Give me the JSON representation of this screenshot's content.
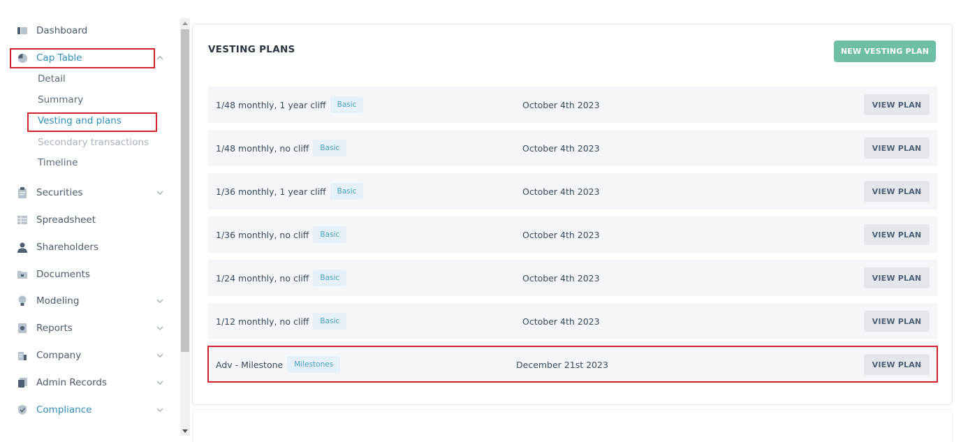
{
  "sidebar": {
    "items": [
      {
        "label": "Dashboard",
        "icon": "dashboard-icon"
      },
      {
        "label": "Cap Table",
        "icon": "pie-chart-icon"
      },
      {
        "label": "Securities",
        "icon": "clipboard-icon"
      },
      {
        "label": "Spreadsheet",
        "icon": "spreadsheet-icon"
      },
      {
        "label": "Shareholders",
        "icon": "person-icon"
      },
      {
        "label": "Documents",
        "icon": "folder-icon"
      },
      {
        "label": "Modeling",
        "icon": "lightbulb-icon"
      },
      {
        "label": "Reports",
        "icon": "report-icon"
      },
      {
        "label": "Company",
        "icon": "building-icon"
      },
      {
        "label": "Admin Records",
        "icon": "admin-records-icon"
      },
      {
        "label": "Compliance",
        "icon": "shield-check-icon"
      }
    ],
    "cap_table_sub": [
      {
        "label": "Detail"
      },
      {
        "label": "Summary"
      },
      {
        "label": "Vesting and plans"
      },
      {
        "label": "Secondary transactions"
      },
      {
        "label": "Timeline"
      }
    ]
  },
  "main": {
    "title": "VESTING PLANS",
    "new_button": "NEW VESTING PLAN",
    "view_label": "VIEW PLAN",
    "plans": [
      {
        "name": "1/48 monthly, 1 year cliff",
        "tag": "Basic",
        "date": "October 4th 2023"
      },
      {
        "name": "1/48 monthly, no cliff",
        "tag": "Basic",
        "date": "October 4th 2023"
      },
      {
        "name": "1/36 monthly, 1 year cliff",
        "tag": "Basic",
        "date": "October 4th 2023"
      },
      {
        "name": "1/36 monthly, no cliff",
        "tag": "Basic",
        "date": "October 4th 2023"
      },
      {
        "name": "1/24 monthly, no cliff",
        "tag": "Basic",
        "date": "October 4th 2023"
      },
      {
        "name": "1/12 monthly, no cliff",
        "tag": "Basic",
        "date": "October 4th 2023"
      },
      {
        "name": "Adv - Milestone",
        "tag": "Milestones",
        "date": "December 21st 2023"
      }
    ]
  },
  "colors": {
    "accent": "#2e8fb8",
    "primary_button": "#6fbfa8",
    "highlight_border": "#d0222c",
    "row_background": "#f4f6f9"
  }
}
